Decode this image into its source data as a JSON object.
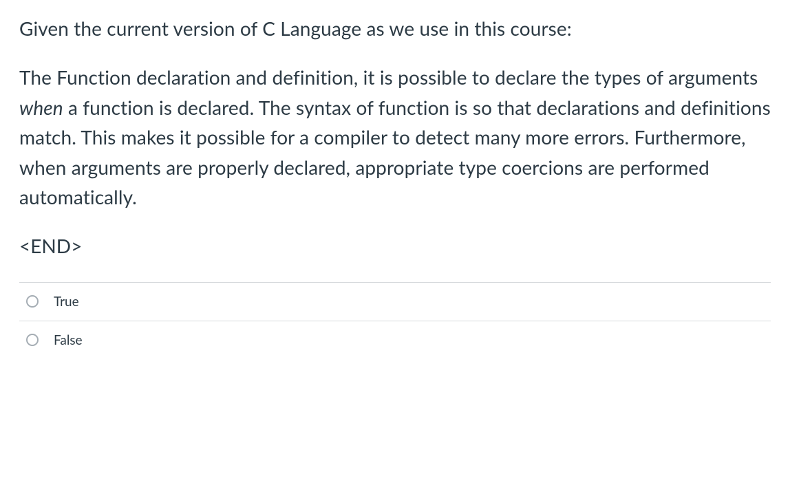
{
  "question": {
    "intro": "Given the current version of C Language as we use in this course:",
    "body_pre": "The Function declaration and definition, it is possible to declare the types of arguments ",
    "body_italic": "when",
    "body_post": " a function is declared. The syntax of function is so that declarations and definitions match. This makes it possible for a compiler to detect many more errors. Furthermore, when arguments are properly declared, appropriate type coercions are performed automatically.",
    "end_marker": "<END>"
  },
  "options": [
    {
      "label": "True"
    },
    {
      "label": "False"
    }
  ]
}
